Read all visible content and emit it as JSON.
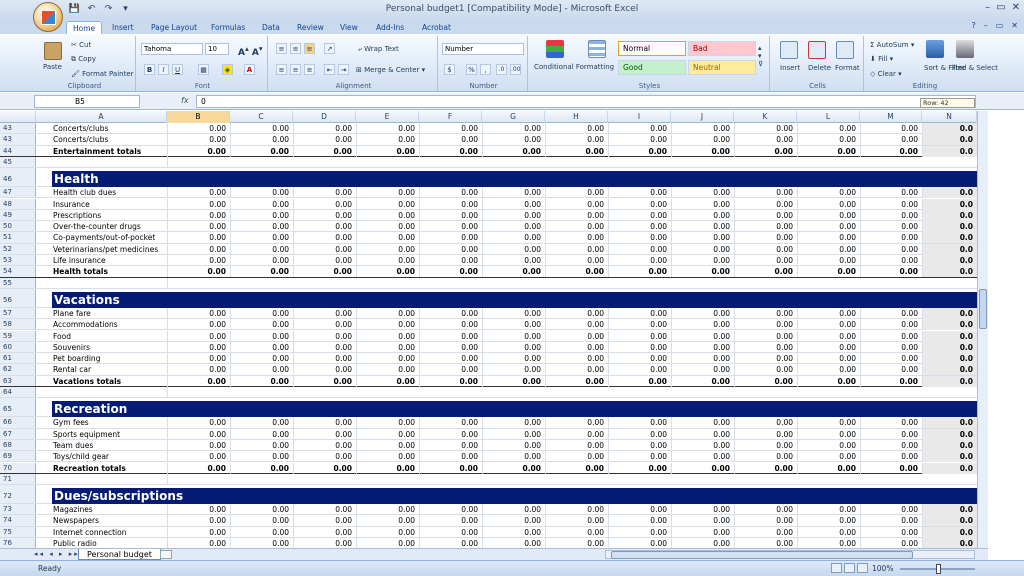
{
  "window": {
    "title": "Personal budget1  [Compatibility Mode] - Microsoft Excel",
    "controls": [
      "–",
      "▭",
      "✕"
    ]
  },
  "qat": [
    "💾",
    "↶",
    "↷",
    "▾"
  ],
  "tabs": [
    "Home",
    "Insert",
    "Page Layout",
    "Formulas",
    "Data",
    "Review",
    "View",
    "Add-Ins",
    "Acrobat"
  ],
  "ribbon": {
    "clipboard": {
      "paste": "Paste",
      "cut": "Cut",
      "copy": "Copy",
      "format_painter": "Format Painter",
      "label": "Clipboard"
    },
    "font": {
      "name": "Tahoma",
      "size": "10",
      "bold": "B",
      "italic": "I",
      "underline": "U",
      "label": "Font"
    },
    "alignment": {
      "wrap": "Wrap Text",
      "merge": "Merge & Center",
      "label": "Alignment"
    },
    "number": {
      "format": "Number",
      "currency": "$",
      "percent": "%",
      "comma": ",",
      "label": "Number"
    },
    "styles": {
      "conditional": "Conditional Formatting",
      "format_table": "Format as Table",
      "normal": "Normal",
      "bad": "Bad",
      "good": "Good",
      "neutral": "Neutral",
      "label": "Styles"
    },
    "cells": {
      "insert": "Insert",
      "delete": "Delete",
      "format": "Format",
      "label": "Cells"
    },
    "editing": {
      "autosum": "AutoSum",
      "fill": "Fill",
      "clear": "Clear",
      "sort": "Sort & Filter",
      "find": "Find & Select",
      "label": "Editing"
    }
  },
  "formula_bar": {
    "name_box": "B5",
    "fx": "fx",
    "content": "0"
  },
  "columns": [
    "A",
    "B",
    "C",
    "D",
    "E",
    "F",
    "G",
    "H",
    "I",
    "J",
    "K",
    "L",
    "M",
    "N"
  ],
  "selected_column": "B",
  "rows": [
    {
      "n": "43",
      "label": "Concerts/clubs",
      "type": "item"
    },
    {
      "n": "43",
      "label": "Concerts/clubs",
      "type": "item"
    },
    {
      "n": "44",
      "label": "Entertainment totals",
      "type": "total"
    },
    {
      "n": "45",
      "label": "",
      "type": "blank"
    },
    {
      "n": "46",
      "label": "Health",
      "type": "header"
    },
    {
      "n": "47",
      "label": "Health club dues",
      "type": "item"
    },
    {
      "n": "48",
      "label": "Insurance",
      "type": "item"
    },
    {
      "n": "49",
      "label": "Prescriptions",
      "type": "item"
    },
    {
      "n": "50",
      "label": "Over-the-counter drugs",
      "type": "item"
    },
    {
      "n": "51",
      "label": "Co-payments/out-of-pocket",
      "type": "item"
    },
    {
      "n": "52",
      "label": "Veterinarians/pet medicines",
      "type": "item"
    },
    {
      "n": "53",
      "label": "Life insurance",
      "type": "item"
    },
    {
      "n": "54",
      "label": "Health totals",
      "type": "total"
    },
    {
      "n": "55",
      "label": "",
      "type": "blank"
    },
    {
      "n": "56",
      "label": "Vacations",
      "type": "header"
    },
    {
      "n": "57",
      "label": "Plane fare",
      "type": "item"
    },
    {
      "n": "58",
      "label": "Accommodations",
      "type": "item"
    },
    {
      "n": "59",
      "label": "Food",
      "type": "item"
    },
    {
      "n": "60",
      "label": "Souvenirs",
      "type": "item"
    },
    {
      "n": "61",
      "label": "Pet boarding",
      "type": "item"
    },
    {
      "n": "62",
      "label": "Rental car",
      "type": "item"
    },
    {
      "n": "63",
      "label": "Vacations totals",
      "type": "total"
    },
    {
      "n": "64",
      "label": "",
      "type": "blank"
    },
    {
      "n": "65",
      "label": "Recreation",
      "type": "header"
    },
    {
      "n": "66",
      "label": "Gym fees",
      "type": "item"
    },
    {
      "n": "67",
      "label": "Sports equipment",
      "type": "item"
    },
    {
      "n": "68",
      "label": "Team dues",
      "type": "item"
    },
    {
      "n": "69",
      "label": "Toys/child gear",
      "type": "item"
    },
    {
      "n": "70",
      "label": "Recreation totals",
      "type": "total"
    },
    {
      "n": "71",
      "label": "",
      "type": "blank"
    },
    {
      "n": "72",
      "label": "Dues/subscriptions",
      "type": "header"
    },
    {
      "n": "73",
      "label": "Magazines",
      "type": "item"
    },
    {
      "n": "74",
      "label": "Newspapers",
      "type": "item"
    },
    {
      "n": "75",
      "label": "Internet connection",
      "type": "item"
    },
    {
      "n": "76",
      "label": "Public radio",
      "type": "item"
    }
  ],
  "cell_value": "0.00",
  "last_col_value": "0.0",
  "tooltip": "Row: 42",
  "sheet_tab": "Personal budget",
  "sheet_nav": "◂◂ ◂ ▸ ▸▸",
  "status": {
    "ready": "Ready",
    "zoom": "100%"
  },
  "colors": {
    "header_band": "#061b73",
    "selected_col": "#f9d99a"
  }
}
